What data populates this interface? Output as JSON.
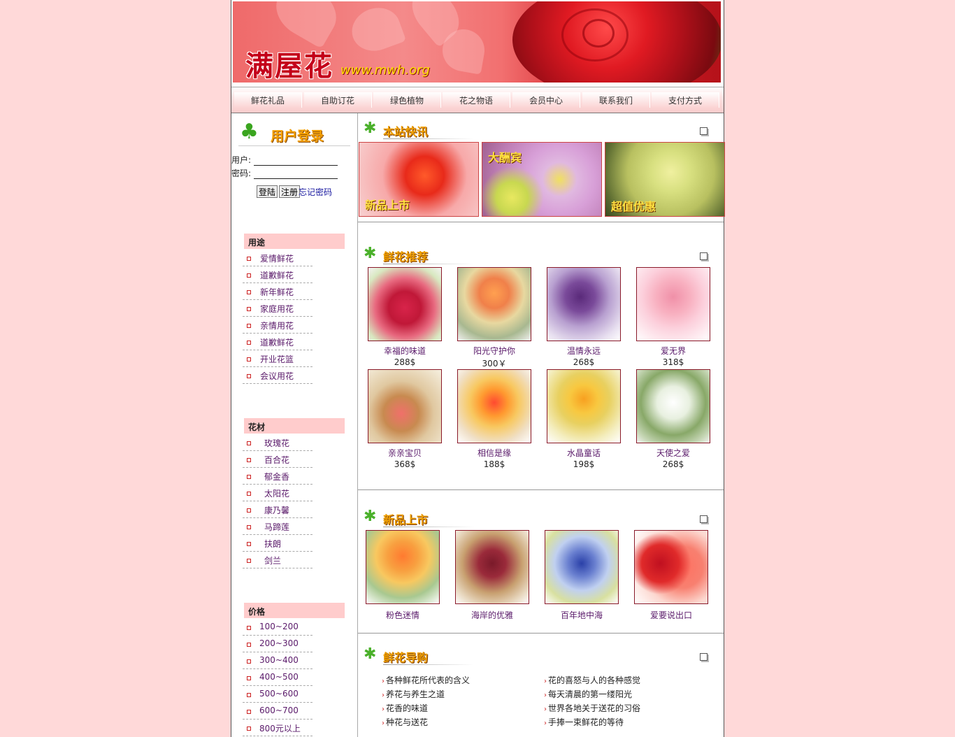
{
  "site": {
    "logo_cn": "满屋花",
    "logo_en": "www.mwh.org"
  },
  "nav": [
    "鲜花礼品",
    "自助订花",
    "绿色植物",
    "花之物语",
    "会员中心",
    "联系我们",
    "支付方式"
  ],
  "login": {
    "title": "用户登录",
    "user_label": "用户:",
    "pass_label": "密码:",
    "user_value": "",
    "pass_value": "",
    "login_btn": "登陆",
    "register_btn": "注册",
    "forgot": "忘记密码"
  },
  "sidebar": {
    "usage": {
      "title": "用途",
      "items": [
        "爱情鲜花",
        "道歉鲜花",
        "新年鲜花",
        "家庭用花",
        "亲情用花",
        "道歉鲜花",
        "开业花篮",
        "会议用花"
      ]
    },
    "material": {
      "title": "花材",
      "items": [
        "玫瑰花",
        "百合花",
        "郁金香",
        "太阳花",
        "康乃馨",
        "马蹄莲",
        "扶朗",
        "剑兰"
      ]
    },
    "price": {
      "title": "价格",
      "items": [
        "100~200",
        "200~300",
        "300~400",
        "400~500",
        "500~600",
        "600~700",
        "800元以上"
      ]
    }
  },
  "news": {
    "title": "本站快讯",
    "promos": [
      "新品上市",
      "大酬宾",
      "超值优惠"
    ]
  },
  "recommend": {
    "title": "鲜花推荐",
    "items": [
      {
        "name": "幸福的味道",
        "price": "288$"
      },
      {
        "name": "阳光守护你",
        "price": "300￥"
      },
      {
        "name": "温情永远",
        "price": "268$"
      },
      {
        "name": "爱无界",
        "price": "318$"
      },
      {
        "name": "亲亲宝贝",
        "price": "368$"
      },
      {
        "name": "相信是缘",
        "price": "188$"
      },
      {
        "name": "水晶童话",
        "price": "198$"
      },
      {
        "name": "天使之爱",
        "price": "268$"
      }
    ]
  },
  "new_arrivals": {
    "title": "新品上市",
    "items": [
      "粉色迷情",
      "海岸的优雅",
      "百年地中海",
      "爱要说出口"
    ]
  },
  "guide": {
    "title": "鲜花导购",
    "left": [
      "各种鲜花所代表的含义",
      "养花与养生之道",
      "花香的味道",
      "种花与送花"
    ],
    "right": [
      "花的喜怒与人的各种感觉",
      "每天清晨的第一缕阳光",
      "世界各地关于送花的习俗",
      "手捧一束鲜花的等待"
    ]
  },
  "colors": {
    "background": "#ffd9d9",
    "accent": "#f0a000",
    "link": "#5a1a6a",
    "banner_red": "#d21c24"
  }
}
